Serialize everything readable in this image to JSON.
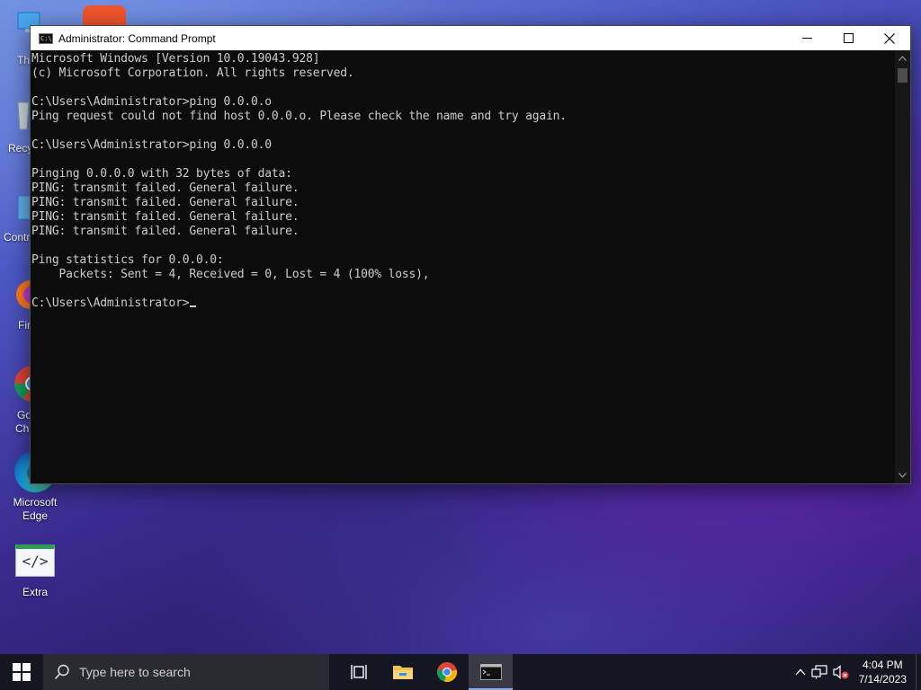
{
  "desktop": {
    "icons": [
      {
        "label": "Microsoft Edge",
        "icon": "edge-icon"
      },
      {
        "label": "Extra",
        "icon": "code-file-icon"
      }
    ],
    "partial_icons": [
      {
        "label": "Th",
        "icon": "this-pc-icon"
      },
      {
        "label": "Recy",
        "icon": "recycle-bin-icon"
      },
      {
        "label": "Contr",
        "icon": "control-panel-icon"
      },
      {
        "label": "Fir",
        "icon": "firefox-icon"
      },
      {
        "label": "Go",
        "icon": "chrome-icon"
      },
      {
        "label": "Chr",
        "icon": "chrome-icon"
      }
    ]
  },
  "cmd_window": {
    "title": "Administrator: Command Prompt",
    "lines": [
      "Microsoft Windows [Version 10.0.19043.928]",
      "(c) Microsoft Corporation. All rights reserved.",
      "",
      "C:\\Users\\Administrator>ping 0.0.0.o",
      "Ping request could not find host 0.0.0.o. Please check the name and try again.",
      "",
      "C:\\Users\\Administrator>ping 0.0.0.0",
      "",
      "Pinging 0.0.0.0 with 32 bytes of data:",
      "PING: transmit failed. General failure.",
      "PING: transmit failed. General failure.",
      "PING: transmit failed. General failure.",
      "PING: transmit failed. General failure.",
      "",
      "Ping statistics for 0.0.0.0:",
      "    Packets: Sent = 4, Received = 0, Lost = 4 (100% loss),",
      "",
      "C:\\Users\\Administrator>"
    ],
    "controls": {
      "minimize": "minimize-icon",
      "maximize": "maximize-icon",
      "close": "close-icon"
    }
  },
  "taskbar": {
    "search_placeholder": "Type here to search",
    "pinned": [
      "task-view-icon",
      "file-explorer-icon",
      "chrome-icon",
      "command-prompt-icon"
    ],
    "active_app": "command-prompt-icon",
    "clock": {
      "time": "4:04 PM",
      "date": "7/14/2023"
    }
  },
  "colors": {
    "console_bg": "#0c0c0c",
    "console_text": "#cccccc",
    "taskbar_bg": "#161623"
  }
}
